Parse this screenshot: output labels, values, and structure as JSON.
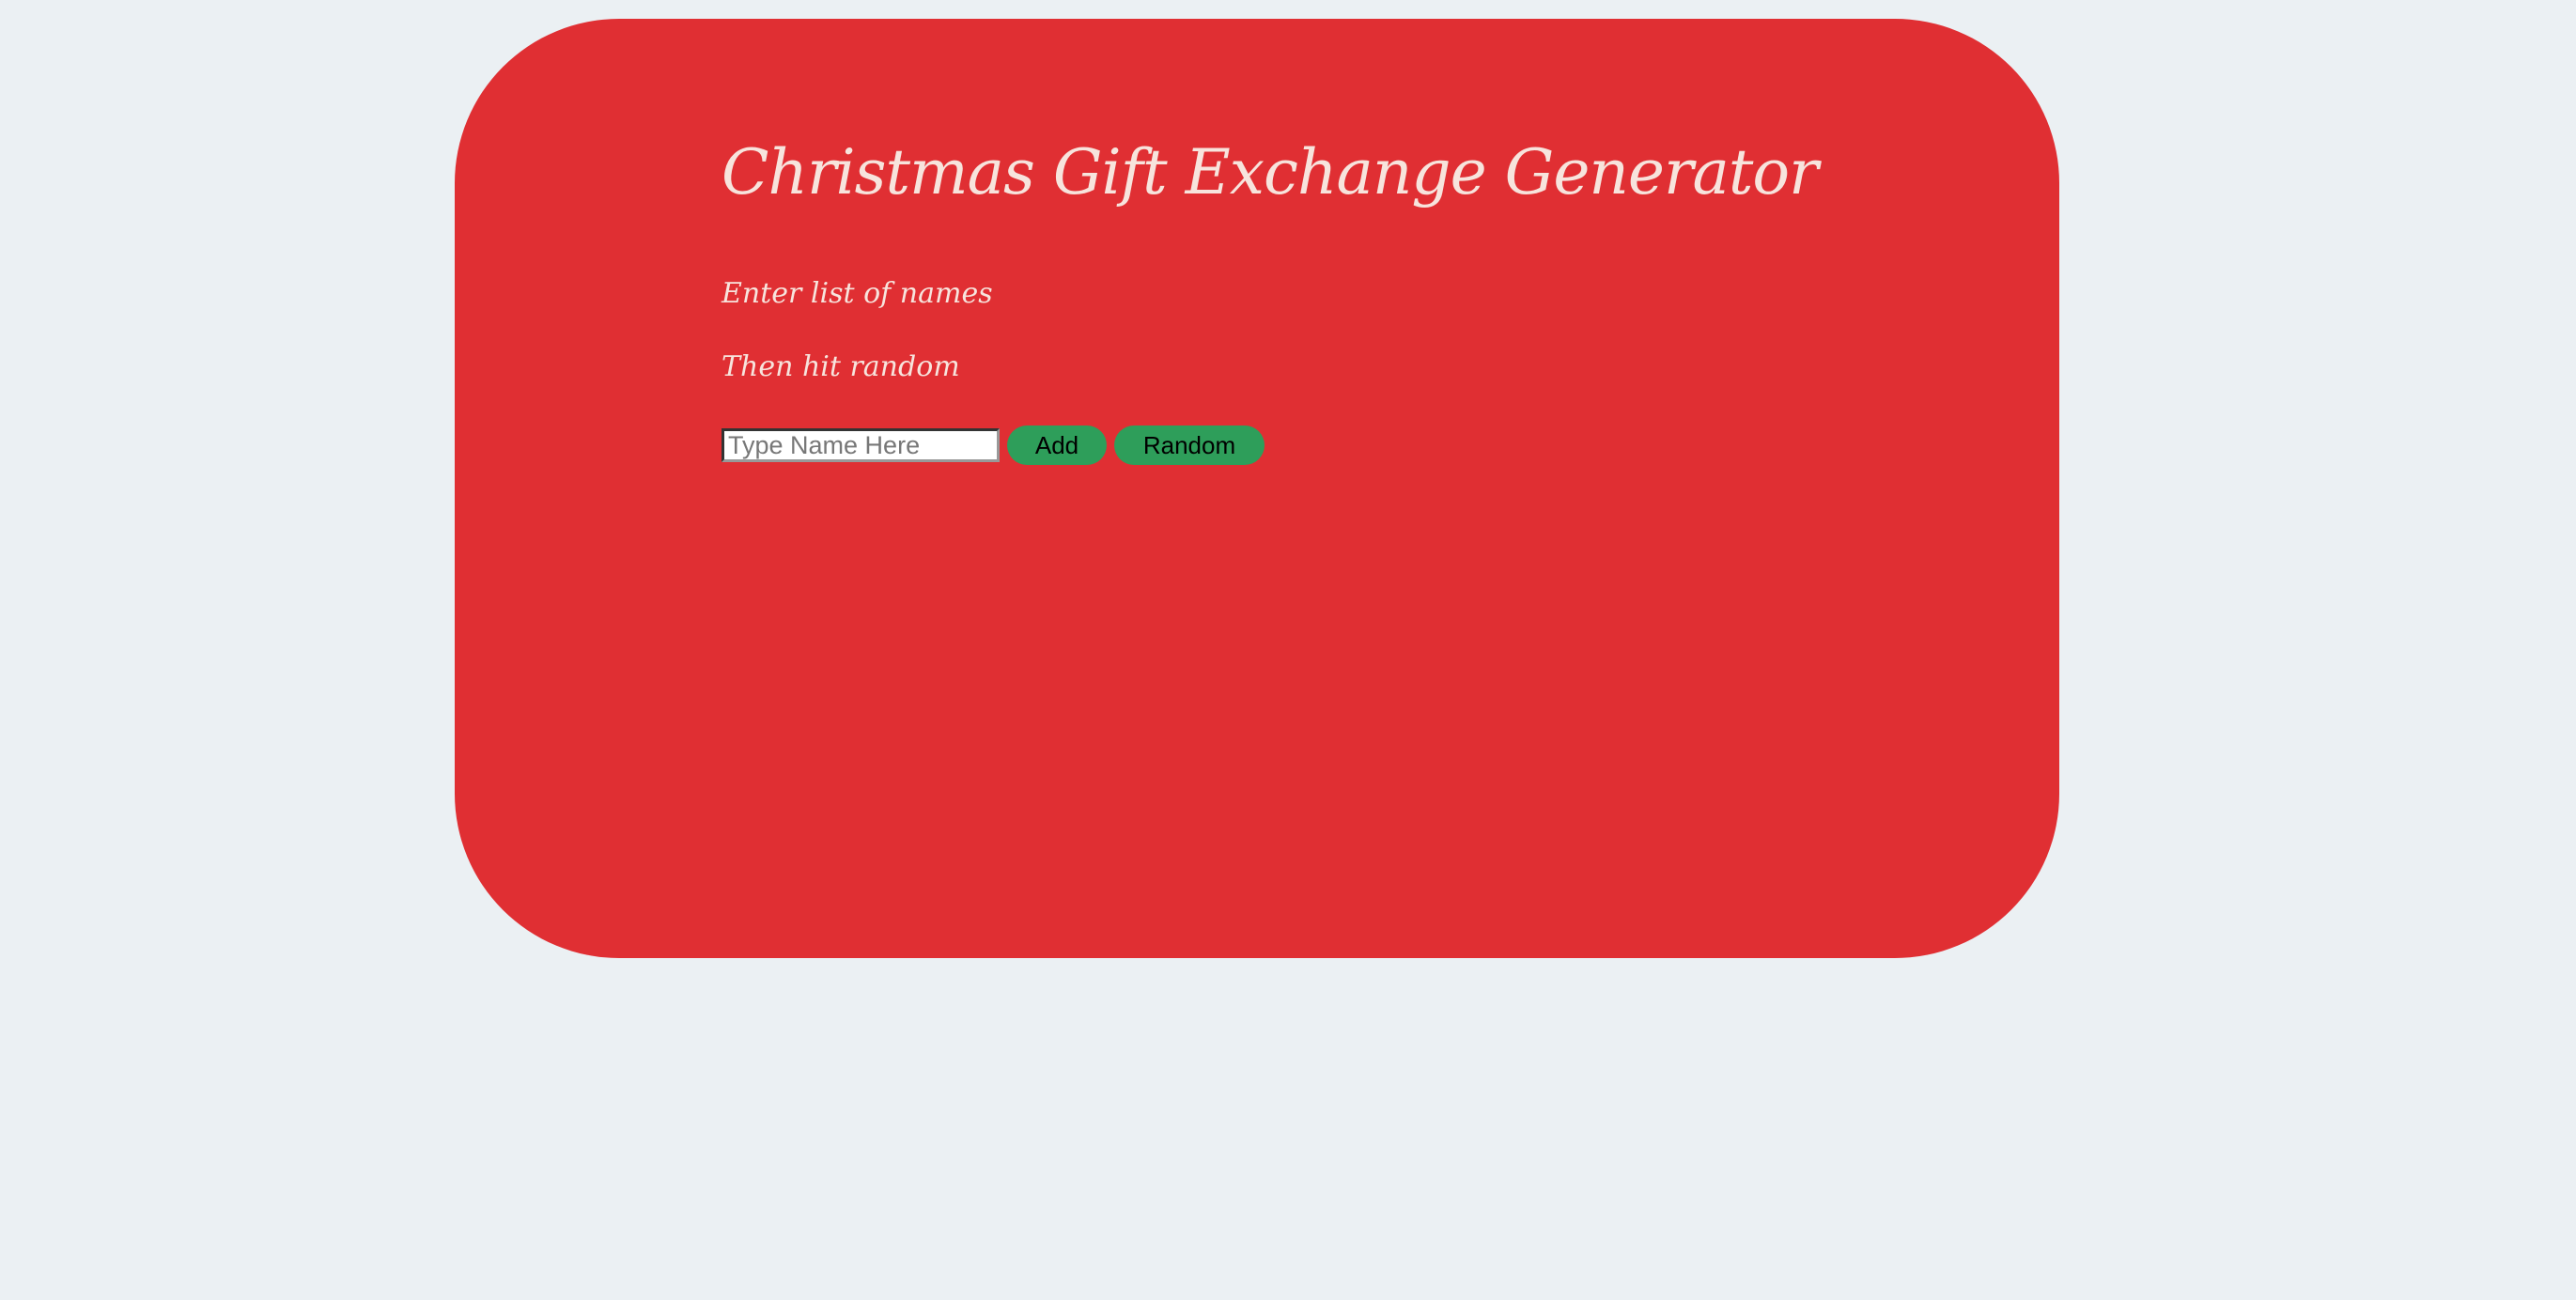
{
  "app": {
    "title": "Christmas Gift Exchange Generator",
    "instructions": [
      "Enter list of names",
      "Then hit random"
    ]
  },
  "form": {
    "name_placeholder": "Type Name Here",
    "name_value": "",
    "add_label": "Add",
    "random_label": "Random"
  },
  "colors": {
    "page_background": "#ebf0f3",
    "card_background": "#e02f33",
    "text": "#f7e4dd",
    "button": "#2e9e5a"
  }
}
